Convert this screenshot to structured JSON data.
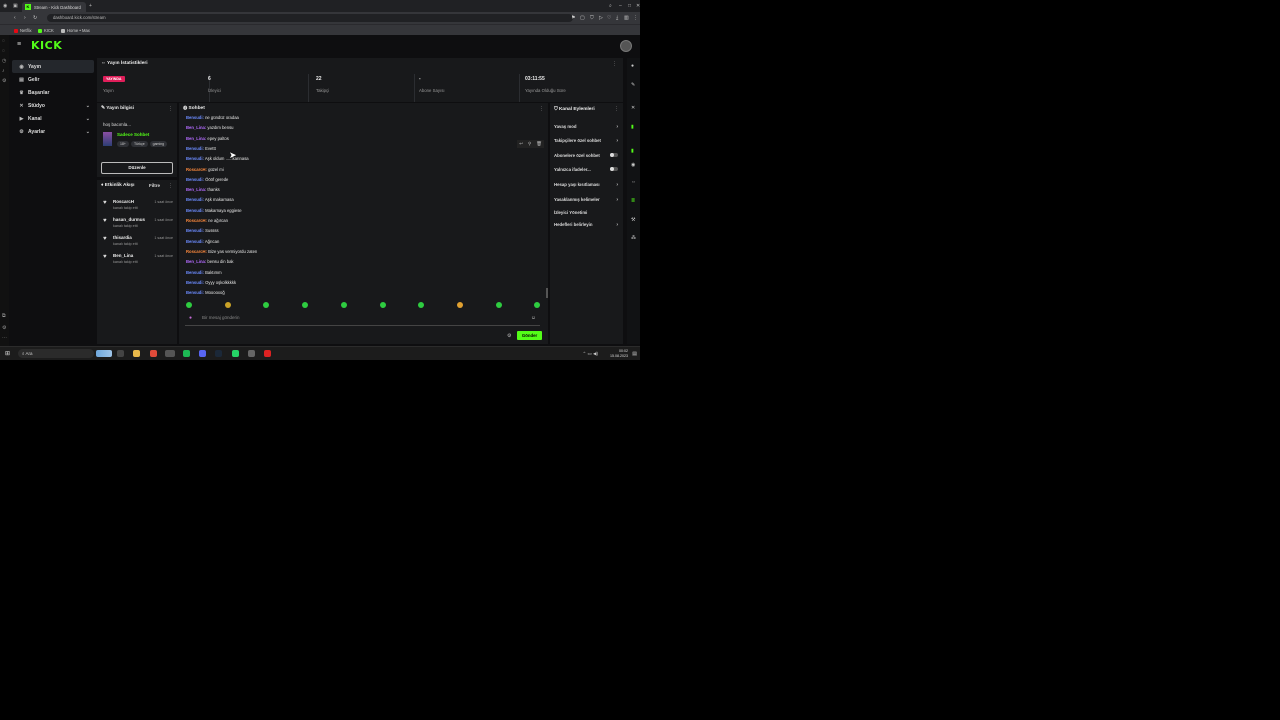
{
  "browser": {
    "tab_title": "Stream - Kick Dashboard",
    "url": "dashboard.kick.com/stream",
    "bookmarks": [
      "Netflix",
      "KICK",
      "Home • Max"
    ]
  },
  "brand": {
    "logo": "KICK",
    "accent": "#53fc18",
    "live_color": "#e01e5a"
  },
  "sidebar": {
    "items": [
      {
        "label": "Yayın",
        "icon": "broadcast-icon",
        "active": true
      },
      {
        "label": "Gelir",
        "icon": "revenue-icon"
      },
      {
        "label": "Başarılar",
        "icon": "trophy-icon"
      },
      {
        "label": "Stüdyo",
        "icon": "studio-icon",
        "expandable": true
      },
      {
        "label": "Kanal",
        "icon": "channel-icon",
        "expandable": true
      },
      {
        "label": "Ayarlar",
        "icon": "settings-icon",
        "expandable": true
      }
    ]
  },
  "stats": {
    "title": "Yayın İstatistikleri",
    "live_badge": "YAYINDA",
    "items": [
      {
        "value": "",
        "label": "Yayın"
      },
      {
        "value": "6",
        "label": "İzleyici"
      },
      {
        "value": "22",
        "label": "Takipçi"
      },
      {
        "value": "-",
        "label": "Abone Sayısı"
      },
      {
        "value": "03:11:55",
        "label": "Yayında Olduğu Süre"
      }
    ]
  },
  "stream_info": {
    "title": "Yayın bilgisi",
    "description": "hoş bacımla...",
    "category": "Sadece Sohbet",
    "tags": [
      "18+",
      "Türkçe",
      "gaming"
    ],
    "edit_label": "Düzenle"
  },
  "activity": {
    "title": "Etkinlik Akışı",
    "filter_label": "Filtre",
    "items": [
      {
        "name": "RoscarcH",
        "action": "kanalı takip etti",
        "time": "1 saat önce"
      },
      {
        "name": "hasan_durmus",
        "action": "kanalı takip etti",
        "time": "1 saat önce"
      },
      {
        "name": "thisardia",
        "action": "kanalı takip etti",
        "time": "1 saat önce"
      },
      {
        "name": "Ben_Lina",
        "action": "kanalı takip etti",
        "time": "1 saat önce"
      }
    ]
  },
  "chat": {
    "title": "Sohbet",
    "messages": [
      {
        "user": "Bensudi:",
        "text": "ne gündüz oradaa",
        "color": "#6c8cff"
      },
      {
        "user": "Ben_Lina:",
        "text": "yazdım bensu",
        "color": "#b36bff"
      },
      {
        "user": "Ben_Lina:",
        "text": "epey paltos",
        "color": "#b36bff"
      },
      {
        "user": "Bensudi:",
        "text": "Evettt",
        "color": "#6c8cff"
      },
      {
        "user": "Bensudi:",
        "text": "Aşk oldum ......karınasa",
        "color": "#6c8cff"
      },
      {
        "user": "RoscarcH:",
        "text": "güzel mi",
        "color": "#ff8a3d"
      },
      {
        "user": "Bensudi:",
        "text": "Öööf gerede",
        "color": "#6c8cff"
      },
      {
        "user": "Ben_Lina:",
        "text": "thanks",
        "color": "#b36bff"
      },
      {
        "user": "Bensudi:",
        "text": "Aşk makarnasa",
        "color": "#6c8cff"
      },
      {
        "user": "Bensudi:",
        "text": "Makarnaya eggiese",
        "color": "#6c8cff"
      },
      {
        "user": "RoscarcH:",
        "text": "ne ağırcan",
        "color": "#ff8a3d"
      },
      {
        "user": "Bensudi:",
        "text": "Sussss",
        "color": "#6c8cff"
      },
      {
        "user": "Bensudi:",
        "text": "Ağrıcan",
        "color": "#6c8cff"
      },
      {
        "user": "RoscarcH:",
        "text": "Bize yas vermiyordu zaten",
        "color": "#ff8a3d"
      },
      {
        "user": "Ben_Lina:",
        "text": "bensu din bak",
        "color": "#b36bff"
      },
      {
        "user": "Bensudi:",
        "text": "Baktımm",
        "color": "#6c8cff"
      },
      {
        "user": "Bensudi:",
        "text": "Oyyy oşkolkkkkk",
        "color": "#6c8cff"
      },
      {
        "user": "Bensudi:",
        "text": "Mooooxoğ",
        "color": "#6c8cff"
      }
    ],
    "input_placeholder": "Bir mesaj gönderin",
    "send_label": "Gönder"
  },
  "channel_actions": {
    "title": "Kanal Eylemleri",
    "items": [
      {
        "label": "Yavaş mod",
        "control": "arrow"
      },
      {
        "label": "Takipçilere özel sohbet",
        "control": "arrow"
      },
      {
        "label": "Abonelere özel sohbet",
        "control": "toggle"
      },
      {
        "label": "Yalnızca ifadeler...",
        "control": "toggle"
      },
      {
        "label": "Hesap yaşı kısıtlaması",
        "control": "arrow"
      },
      {
        "label": "Yasaklanmış kelimeler",
        "control": "arrow"
      },
      {
        "label": "İzleyici Yönetimi",
        "control": "none"
      },
      {
        "label": "Hedefleri belirleyin",
        "control": "arrow"
      }
    ]
  },
  "taskbar": {
    "search_label": "Ara",
    "time": "00:02",
    "date": "15.08.2023"
  }
}
